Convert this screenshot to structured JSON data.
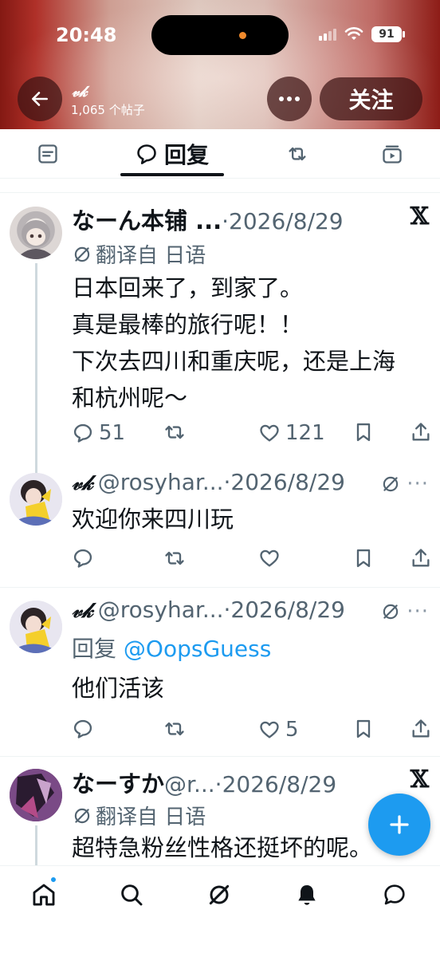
{
  "status_bar": {
    "time": "20:48",
    "battery": "91"
  },
  "header": {
    "profile_name": "𝓋𝓀",
    "posts_count": "1,065 个帖子",
    "follow_label": "关注"
  },
  "tabs": [
    {
      "label": "",
      "icon": "posts-icon"
    },
    {
      "label": "回复",
      "icon": "reply-icon",
      "active": true
    },
    {
      "label": "",
      "icon": "retweet-icon"
    },
    {
      "label": "",
      "icon": "media-icon"
    }
  ],
  "posts": [
    {
      "name": "なーん本铺 ...",
      "handle": "",
      "date": "·2026/8/29",
      "translated": "翻译自 日语",
      "text_lines": [
        "日本回来了，到家了。",
        "真是最棒的旅行呢！！",
        "下次去四川和重庆呢，还是上海",
        "和杭州呢～"
      ],
      "replies": "51",
      "retweets": "",
      "likes": "121"
    },
    {
      "name": "𝓋𝓀",
      "handle": "@rosyhar...",
      "date": "·2026/8/29",
      "text_lines": [
        "欢迎你来四川玩"
      ],
      "replies": "",
      "retweets": "",
      "likes": ""
    },
    {
      "name": "𝓋𝓀",
      "handle": "@rosyhar...",
      "date": "·2026/8/29",
      "reply_prefix": "回复",
      "reply_mention": "@OopsGuess",
      "text_lines": [
        "他们活该"
      ],
      "replies": "",
      "retweets": "",
      "likes": "5"
    },
    {
      "name": "なーすか",
      "handle": " @r...",
      "date": "·2026/8/29",
      "translated": "翻译自 日语",
      "text_lines": [
        "超特急粉丝性格还挺坏的呢。"
      ]
    }
  ],
  "more_glyph": "···",
  "x_glyph": "𝕏",
  "colors": {
    "accent": "#1d9bf0",
    "text": "#0f1419",
    "muted": "#536471"
  }
}
